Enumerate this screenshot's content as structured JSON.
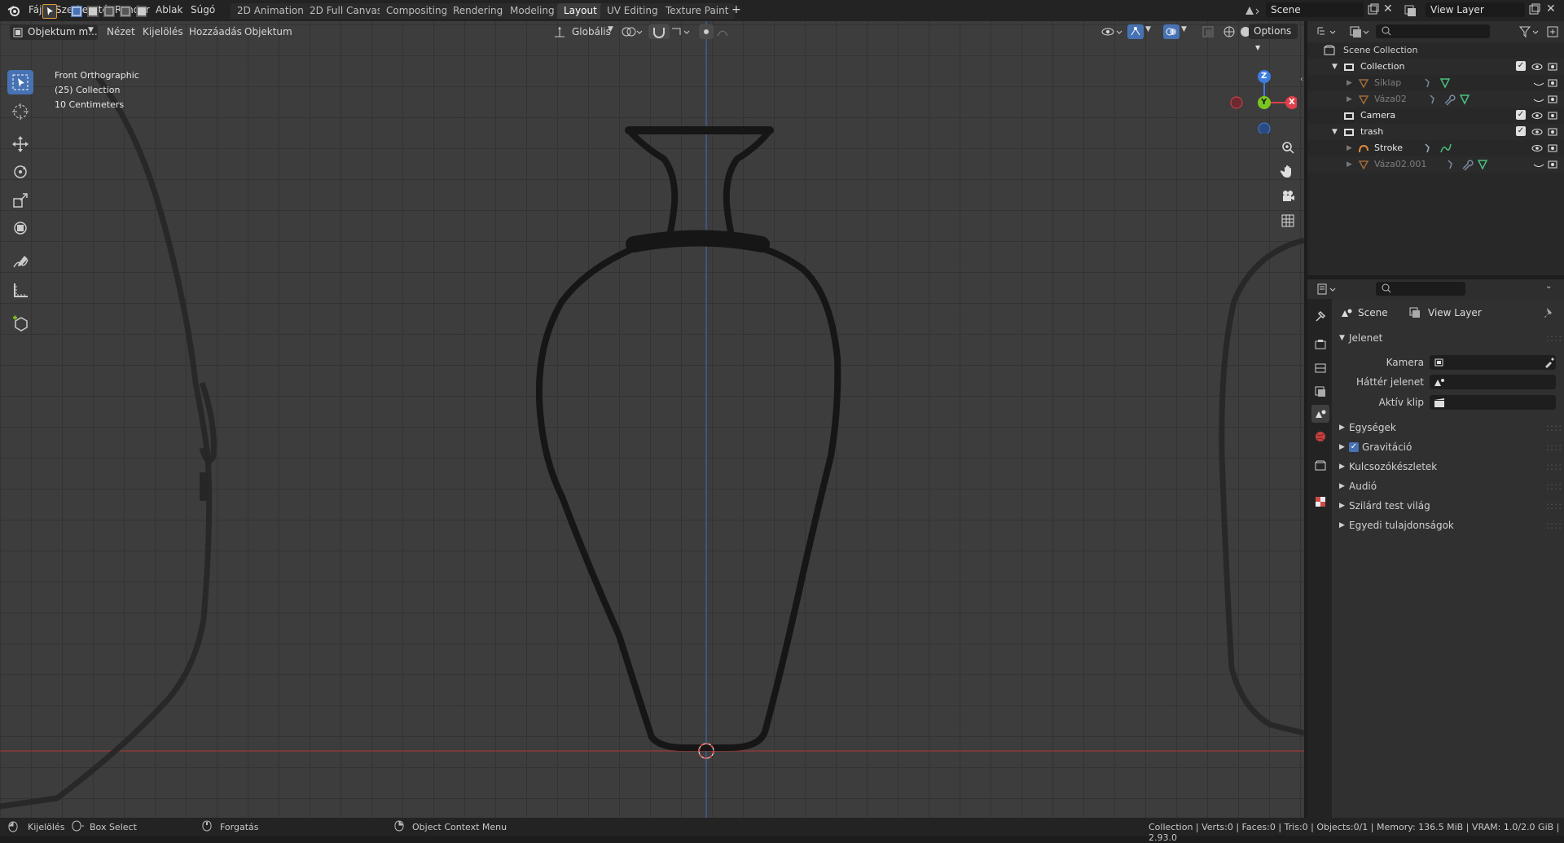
{
  "topbar": {
    "menus": [
      "Fájl",
      "Szerkesztés",
      "Render",
      "Ablak",
      "Súgó"
    ],
    "workspaces": [
      "2D Animation",
      "2D Full Canvas",
      "Compositing",
      "Rendering",
      "Modeling",
      "Layout",
      "UV Editing",
      "Texture Paint"
    ],
    "active_workspace": "Layout",
    "add_workspace": "+",
    "scene_name": "Scene",
    "view_layer": "View Layer"
  },
  "viewport_header": {
    "mode": "Objektum m...",
    "menus": [
      "Nézet",
      "Kijelölés",
      "Hozzáadás",
      "Objektum"
    ],
    "transform_orientation": "Globális",
    "options_label": "Options"
  },
  "viewport_overlay": {
    "view_name": "Front Orthographic",
    "collection": "(25) Collection",
    "scale": "10 Centimeters"
  },
  "gizmo": {
    "z": "Z",
    "y": "Y",
    "x": "X"
  },
  "outliner": {
    "root": "Scene Collection",
    "rows": [
      {
        "label": "Collection",
        "level": 1,
        "type": "collection",
        "dim": false
      },
      {
        "label": "Síklap",
        "level": 2,
        "type": "mesh",
        "dim": true
      },
      {
        "label": "Váza02",
        "level": 2,
        "type": "mesh",
        "dim": true
      },
      {
        "label": "Camera",
        "level": 1,
        "type": "collection",
        "dim": false
      },
      {
        "label": "trash",
        "level": 1,
        "type": "collection",
        "dim": false
      },
      {
        "label": "Stroke",
        "level": 2,
        "type": "gpencil",
        "dim": false
      },
      {
        "label": "Váza02.001",
        "level": 2,
        "type": "mesh",
        "dim": true
      }
    ]
  },
  "properties": {
    "breadcrumb_scene": "Scene",
    "breadcrumb_viewlayer": "View Layer",
    "panel_title": "Jelenet",
    "fields": [
      {
        "label": "Kamera",
        "value": ""
      },
      {
        "label": "Háttér jelenet",
        "value": ""
      },
      {
        "label": "Aktív klip",
        "value": ""
      }
    ],
    "subpanels": [
      "Egységek",
      "Gravitáció",
      "Kulcsozókészletek",
      "Audió",
      "Szilárd test világ",
      "Egyedi tulajdonságok"
    ],
    "gravity_checked": true
  },
  "statusbar": {
    "select": "Kijelölés",
    "box_select": "Box Select",
    "rotate": "Forgatás",
    "context_menu": "Object Context Menu",
    "stats": "Collection | Verts:0 | Faces:0 | Tris:0 | Objects:0/1 | Memory: 136.5 MiB | VRAM: 1.0/2.0 GiB | 2.93.0"
  },
  "colors": {
    "accent": "#4772b3",
    "x_axis": "#e0404b",
    "y_axis": "#7ac620",
    "z_axis": "#3d7de0"
  }
}
